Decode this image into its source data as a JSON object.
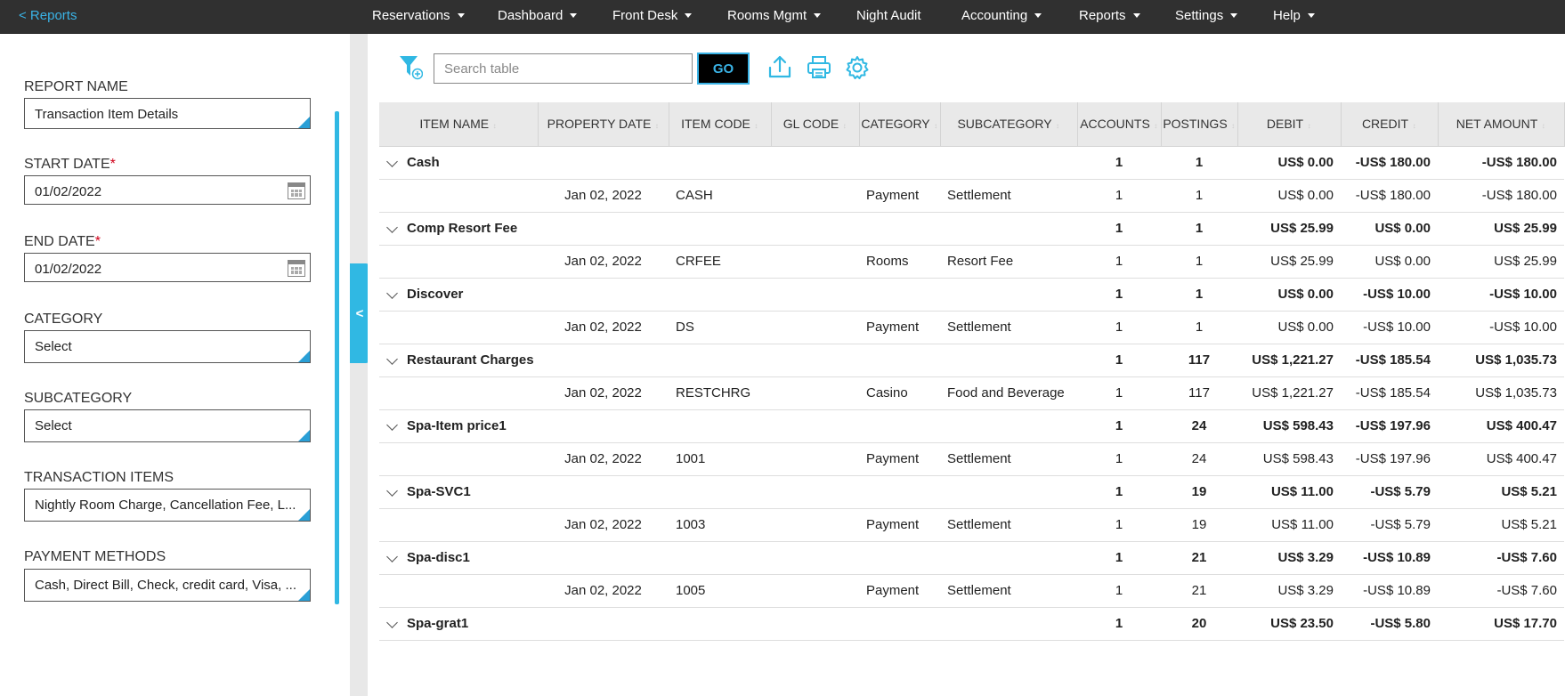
{
  "topnav": {
    "back_label": "< Reports",
    "items": [
      {
        "label": "Reservations",
        "caret": true
      },
      {
        "label": "Dashboard",
        "caret": true
      },
      {
        "label": "Front Desk",
        "caret": true
      },
      {
        "label": "Rooms Mgmt",
        "caret": true
      },
      {
        "label": "Night Audit",
        "caret": false
      },
      {
        "label": "Accounting",
        "caret": true
      },
      {
        "label": "Reports",
        "caret": true
      },
      {
        "label": "Settings",
        "caret": true
      },
      {
        "label": "Help",
        "caret": true
      }
    ]
  },
  "sidebar": {
    "report_name": {
      "label": "REPORT NAME",
      "value": "Transaction Item Details"
    },
    "start_date": {
      "label": "START DATE",
      "required": "*",
      "value": "01/02/2022"
    },
    "end_date": {
      "label": "END DATE",
      "required": "*",
      "value": "01/02/2022"
    },
    "category": {
      "label": "CATEGORY",
      "value": "Select"
    },
    "subcategory": {
      "label": "SUBCATEGORY",
      "value": "Select"
    },
    "transaction_items": {
      "label": "TRANSACTION ITEMS",
      "value": "Nightly Room Charge, Cancellation Fee, L..."
    },
    "payment_methods": {
      "label": "PAYMENT METHODS",
      "value": "Cash, Direct Bill, Check, credit card, Visa, ..."
    },
    "collapse_label": "<"
  },
  "toolbar": {
    "search_placeholder": "Search table",
    "go_label": "GO",
    "icons": [
      "filter-add-icon",
      "export-upload-icon",
      "print-icon",
      "settings-gear-icon"
    ],
    "accent_color": "#30b8e3"
  },
  "table": {
    "columns": [
      "ITEM NAME",
      "PROPERTY DATE",
      "ITEM CODE",
      "GL CODE",
      "CATEGORY",
      "SUBCATEGORY",
      "ACCOUNTS",
      "POSTINGS",
      "DEBIT",
      "CREDIT",
      "NET AMOUNT"
    ],
    "groups": [
      {
        "name": "Cash",
        "accounts": "1",
        "postings": "1",
        "debit": "US$ 0.00",
        "credit": "-US$ 180.00",
        "net": "-US$ 180.00",
        "detail": {
          "date": "Jan 02, 2022",
          "code": "CASH",
          "gl": "",
          "category": "Payment",
          "subcategory": "Settlement",
          "accounts": "1",
          "postings": "1",
          "debit": "US$ 0.00",
          "credit": "-US$ 180.00",
          "net": "-US$ 180.00"
        }
      },
      {
        "name": "Comp Resort Fee",
        "accounts": "1",
        "postings": "1",
        "debit": "US$ 25.99",
        "credit": "US$ 0.00",
        "net": "US$ 25.99",
        "detail": {
          "date": "Jan 02, 2022",
          "code": "CRFEE",
          "gl": "",
          "category": "Rooms",
          "subcategory": "Resort Fee",
          "accounts": "1",
          "postings": "1",
          "debit": "US$ 25.99",
          "credit": "US$ 0.00",
          "net": "US$ 25.99"
        }
      },
      {
        "name": "Discover",
        "accounts": "1",
        "postings": "1",
        "debit": "US$ 0.00",
        "credit": "-US$ 10.00",
        "net": "-US$ 10.00",
        "detail": {
          "date": "Jan 02, 2022",
          "code": "DS",
          "gl": "",
          "category": "Payment",
          "subcategory": "Settlement",
          "accounts": "1",
          "postings": "1",
          "debit": "US$ 0.00",
          "credit": "-US$ 10.00",
          "net": "-US$ 10.00"
        }
      },
      {
        "name": "Restaurant Charges",
        "accounts": "1",
        "postings": "117",
        "debit": "US$ 1,221.27",
        "credit": "-US$ 185.54",
        "net": "US$ 1,035.73",
        "detail": {
          "date": "Jan 02, 2022",
          "code": "RESTCHRG",
          "gl": "",
          "category": "Casino",
          "subcategory": "Food and Beverage",
          "accounts": "1",
          "postings": "117",
          "debit": "US$ 1,221.27",
          "credit": "-US$ 185.54",
          "net": "US$ 1,035.73"
        }
      },
      {
        "name": "Spa-Item price1",
        "accounts": "1",
        "postings": "24",
        "debit": "US$ 598.43",
        "credit": "-US$ 197.96",
        "net": "US$ 400.47",
        "detail": {
          "date": "Jan 02, 2022",
          "code": "1001",
          "gl": "",
          "category": "Payment",
          "subcategory": "Settlement",
          "accounts": "1",
          "postings": "24",
          "debit": "US$ 598.43",
          "credit": "-US$ 197.96",
          "net": "US$ 400.47"
        }
      },
      {
        "name": "Spa-SVC1",
        "accounts": "1",
        "postings": "19",
        "debit": "US$ 11.00",
        "credit": "-US$ 5.79",
        "net": "US$ 5.21",
        "detail": {
          "date": "Jan 02, 2022",
          "code": "1003",
          "gl": "",
          "category": "Payment",
          "subcategory": "Settlement",
          "accounts": "1",
          "postings": "19",
          "debit": "US$ 11.00",
          "credit": "-US$ 5.79",
          "net": "US$ 5.21"
        }
      },
      {
        "name": "Spa-disc1",
        "accounts": "1",
        "postings": "21",
        "debit": "US$ 3.29",
        "credit": "-US$ 10.89",
        "net": "-US$ 7.60",
        "detail": {
          "date": "Jan 02, 2022",
          "code": "1005",
          "gl": "",
          "category": "Payment",
          "subcategory": "Settlement",
          "accounts": "1",
          "postings": "21",
          "debit": "US$ 3.29",
          "credit": "-US$ 10.89",
          "net": "-US$ 7.60"
        }
      },
      {
        "name": "Spa-grat1",
        "accounts": "1",
        "postings": "20",
        "debit": "US$ 23.50",
        "credit": "-US$ 5.80",
        "net": "US$ 17.70",
        "detail": null
      }
    ]
  }
}
